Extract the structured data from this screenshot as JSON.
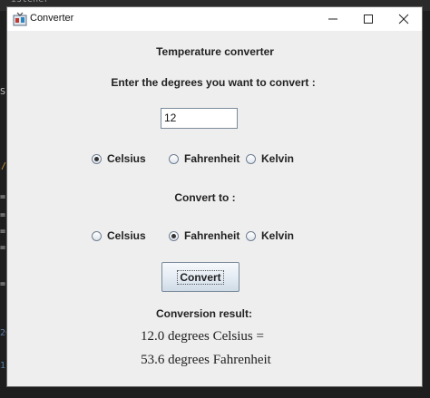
{
  "background_editor": {
    "top_text": "istener",
    "left_glyphs": [
      "S",
      "/",
      "=",
      "=",
      "=",
      "=",
      "=",
      "20",
      "1"
    ]
  },
  "window": {
    "title": "Converter",
    "controls": {
      "minimize": "minimize",
      "maximize": "maximize",
      "close": "close"
    }
  },
  "form": {
    "heading": "Temperature converter",
    "prompt": "Enter the degrees you want to convert :",
    "degrees_value": "12",
    "from_units": [
      {
        "label": "Celsius",
        "checked": true
      },
      {
        "label": "Fahrenheit",
        "checked": false
      },
      {
        "label": "Kelvin",
        "checked": false
      }
    ],
    "convert_to_label": "Convert to :",
    "to_units": [
      {
        "label": "Celsius",
        "checked": false
      },
      {
        "label": "Fahrenheit",
        "checked": true
      },
      {
        "label": "Kelvin",
        "checked": false
      }
    ],
    "convert_button": "Convert",
    "result_heading": "Conversion result:",
    "result_line1": "12.0 degrees Celsius =",
    "result_line2": "53.6 degrees Fahrenheit"
  },
  "colors": {
    "window_bg": "#eeeeee",
    "titlebar_bg": "#ffffff",
    "desktop_bg": "#1e1e1e"
  }
}
